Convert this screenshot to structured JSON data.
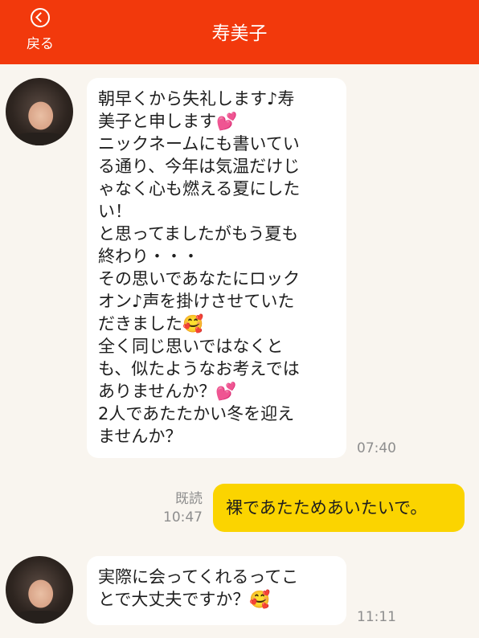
{
  "header": {
    "back_label": "戻る",
    "title": "寿美子"
  },
  "messages": [
    {
      "direction": "incoming",
      "lines": [
        "朝早くから失礼します♪寿",
        "美子と申します💕",
        "ニックネームにも書いてい",
        "る通り、今年は気温だけじ",
        "ゃなく心も燃える夏にした",
        "い！",
        "と思ってましたがもう夏も",
        "終わり・・・",
        "その思いであなたにロック",
        "オン♪声を掛けさせていた",
        "だきました🥰",
        "全く同じ思いではなくと",
        "も、似たようなお考えでは",
        "ありませんか？💕",
        "2人であたたかい冬を迎え",
        "ませんか？"
      ],
      "time": "07:40"
    },
    {
      "direction": "outgoing",
      "text": "裸であたためあいたいで。",
      "read": "既読",
      "time": "10:47"
    },
    {
      "direction": "incoming",
      "lines": [
        "実際に会ってくれるってこ",
        "とで大丈夫ですか？🥰"
      ],
      "time": "11:11"
    }
  ],
  "colors": {
    "header": "#f2390c",
    "background": "#f9f5ef",
    "outgoing_bubble": "#fbd400",
    "incoming_bubble": "#ffffff"
  }
}
